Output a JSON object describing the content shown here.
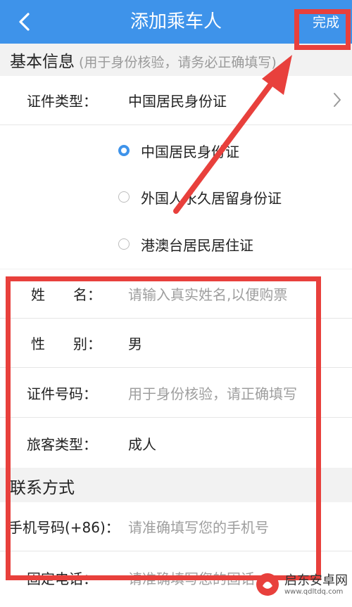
{
  "header": {
    "title": "添加乘车人",
    "done_label": "完成"
  },
  "basic_info": {
    "title": "基本信息",
    "hint": "(用于身份核验，请务必正确填写)"
  },
  "id_type": {
    "label": "证件类型：",
    "value": "中国居民身份证",
    "options": [
      {
        "label": "中国居民身份证",
        "checked": true
      },
      {
        "label": "外国人永久居留身份证",
        "checked": false
      },
      {
        "label": "港澳台居民居住证",
        "checked": false
      }
    ]
  },
  "fields": {
    "name_label": "姓　　名：",
    "name_placeholder": "请输入真实姓名,以便购票",
    "gender_label": "性　　别：",
    "gender_value": "男",
    "id_number_label": "证件号码：",
    "id_number_placeholder": "用于身份核验，请正确填写",
    "passenger_type_label": "旅客类型：",
    "passenger_type_value": "成人"
  },
  "contact": {
    "title": "联系方式",
    "mobile_label": "手机号码(+86)：",
    "mobile_placeholder": "请准确填写您的手机号",
    "phone_label": "固定电话：",
    "phone_placeholder": "请准确填写您的固话"
  },
  "watermark": {
    "text": "启东安卓网",
    "sub": "www.qdltdq.com"
  },
  "colors": {
    "header_bg": "#3e93ea",
    "annotation_red": "#e8403c"
  }
}
